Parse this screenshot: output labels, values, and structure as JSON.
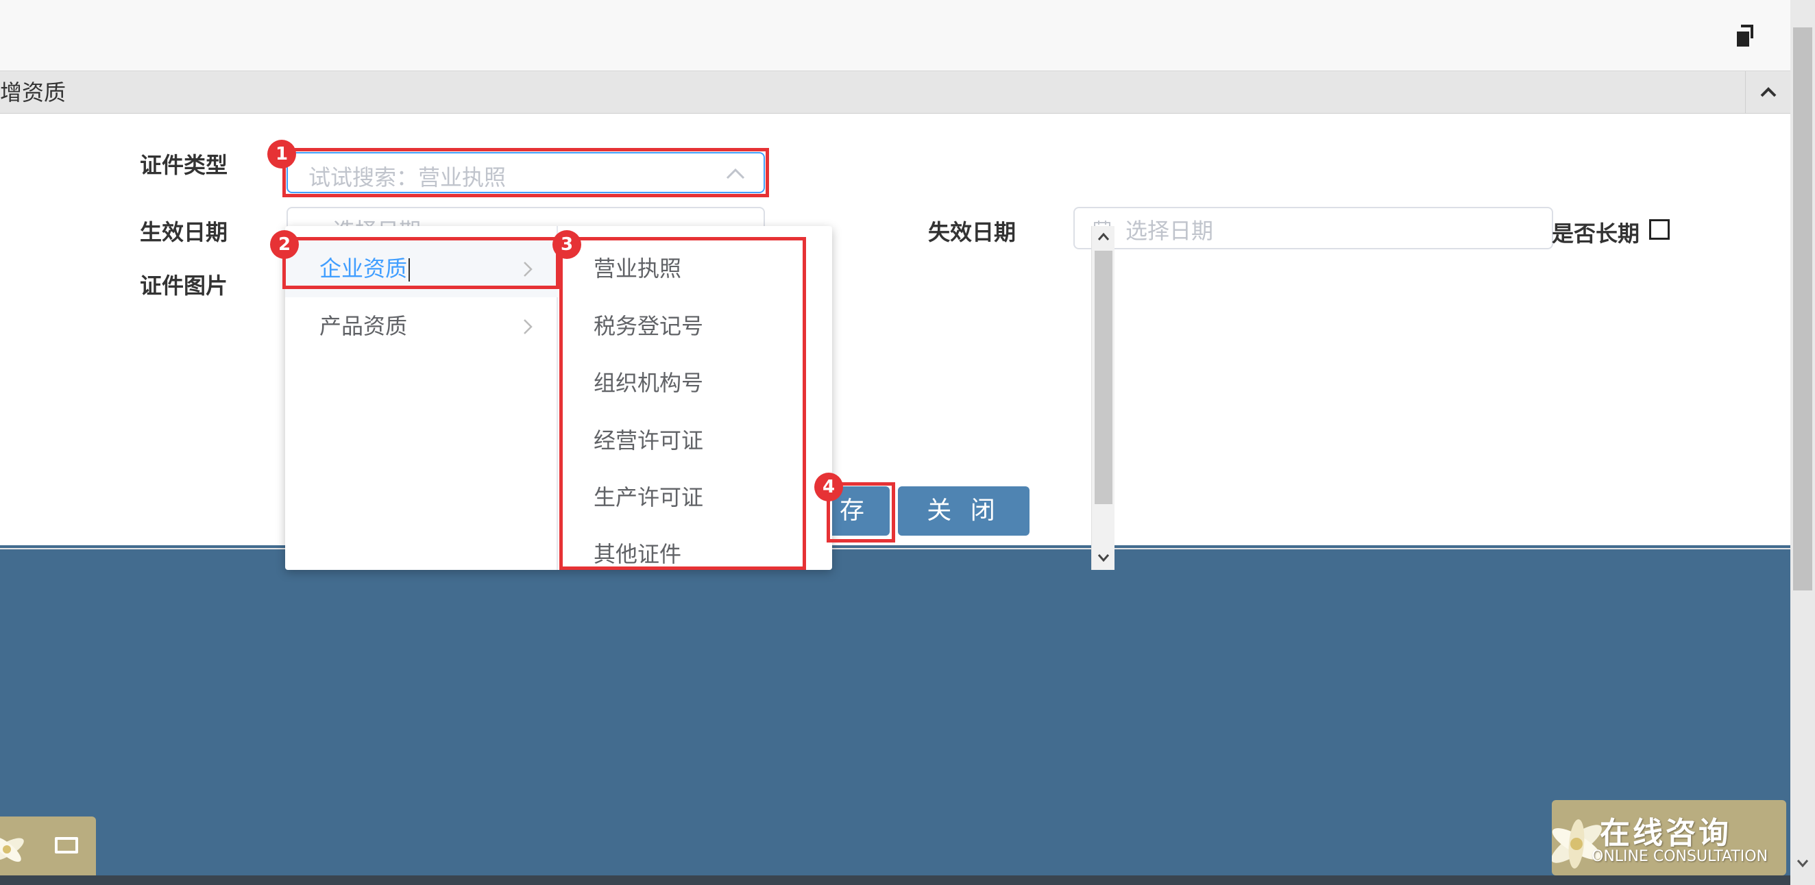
{
  "panel": {
    "title": "增资质"
  },
  "form": {
    "cert_type_label": "证件类型",
    "cert_type_placeholder": "试试搜索：营业执照",
    "effective_date_label": "生效日期",
    "effective_date_placeholder": "选择日期",
    "expiry_date_label": "失效日期",
    "expiry_date_placeholder": "选择日期",
    "long_term_label": "是否长期",
    "cert_image_label": "证件图片"
  },
  "buttons": {
    "save_label": "存",
    "close_label": "关 闭"
  },
  "cascader": {
    "level1": [
      {
        "label": "企业资质",
        "active": true
      },
      {
        "label": "产品资质",
        "active": false
      }
    ],
    "level2": [
      "营业执照",
      "税务登记号",
      "组织机构号",
      "经营许可证",
      "生产许可证",
      "其他证件"
    ]
  },
  "annotations": [
    "1",
    "2",
    "3",
    "4"
  ],
  "online": {
    "main": "在线咨询",
    "sub": "ONLINE CONSULTATION"
  },
  "colors": {
    "accent": "#4f84b2",
    "annotation": "#e63235",
    "background": "#436c8f",
    "active_item": "#409eff"
  }
}
